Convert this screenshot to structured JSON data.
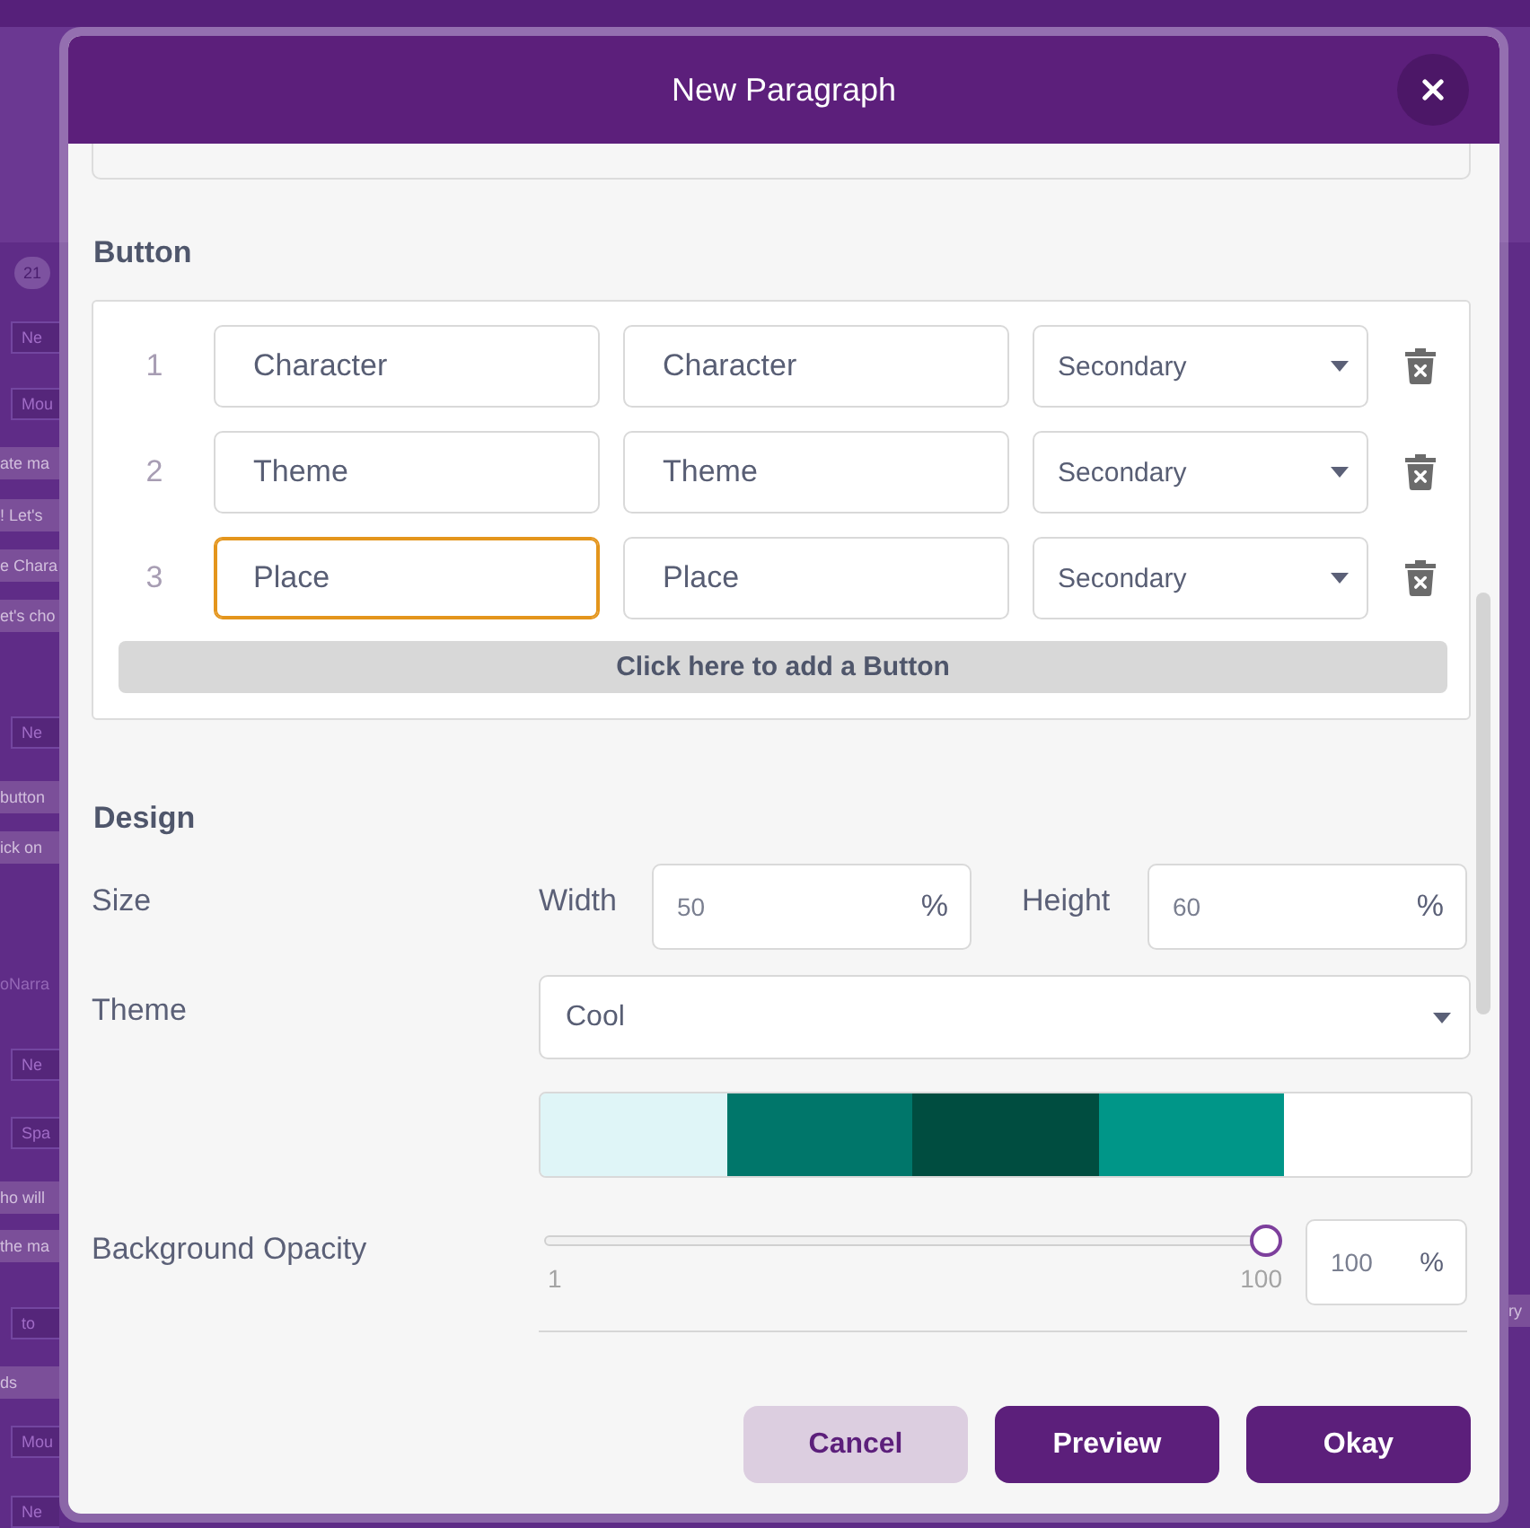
{
  "backdrop": {
    "left_fragments": [
      {
        "kind": "badge",
        "text": "21"
      },
      {
        "kind": "chip",
        "text": "Ne"
      },
      {
        "kind": "chip",
        "text": "Mou"
      },
      {
        "kind": "line",
        "text": "ate ma"
      },
      {
        "kind": "line",
        "text": "! Let's"
      },
      {
        "kind": "line",
        "text": "e Chara"
      },
      {
        "kind": "line",
        "text": "et's cho"
      },
      {
        "kind": "chip",
        "text": "Ne"
      },
      {
        "kind": "line",
        "text": "button"
      },
      {
        "kind": "line",
        "text": "ick on"
      },
      {
        "kind": "heading",
        "text": "oNarra"
      },
      {
        "kind": "chip",
        "text": "Ne"
      },
      {
        "kind": "chip",
        "text": "Spa"
      },
      {
        "kind": "line",
        "text": "ho will"
      },
      {
        "kind": "line",
        "text": "the ma"
      },
      {
        "kind": "chip",
        "text": "to"
      },
      {
        "kind": "line",
        "text": "ds"
      },
      {
        "kind": "chip",
        "text": "Mou"
      },
      {
        "kind": "chip",
        "text": "Ne"
      }
    ],
    "right_fragments": [
      {
        "kind": "line",
        "text": "ry"
      }
    ]
  },
  "dialog": {
    "title": "New Paragraph"
  },
  "button_section": {
    "heading": "Button",
    "rows": [
      {
        "number": "1",
        "fields": [
          {
            "value": "Character",
            "focused": false
          },
          {
            "value": "Character",
            "focused": false
          }
        ],
        "style": "Secondary"
      },
      {
        "number": "2",
        "fields": [
          {
            "value": "Theme",
            "focused": false
          },
          {
            "value": "Theme",
            "focused": false
          }
        ],
        "style": "Secondary"
      },
      {
        "number": "3",
        "fields": [
          {
            "value": "Place",
            "focused": true
          },
          {
            "value": "Place",
            "focused": false
          }
        ],
        "style": "Secondary"
      }
    ],
    "add_button": "Click here to add a Button"
  },
  "design_section": {
    "heading": "Design",
    "size": {
      "label": "Size",
      "width_label": "Width",
      "width_value": "50",
      "width_unit": "%",
      "height_label": "Height",
      "height_value": "60",
      "height_unit": "%"
    },
    "theme": {
      "label": "Theme",
      "value": "Cool",
      "palette": [
        {
          "color": "#dff5f7"
        },
        {
          "color": "#00766a"
        },
        {
          "color": "#004d40"
        },
        {
          "color": "#009688"
        },
        {
          "color": "#ffffff"
        }
      ]
    },
    "opacity": {
      "label": "Background Opacity",
      "level": 1,
      "min": "1",
      "max": "100",
      "value": "100",
      "unit": "%"
    }
  },
  "footer": {
    "buttons": [
      {
        "label": "Cancel",
        "kind": "secondary"
      },
      {
        "label": "Preview",
        "kind": "primary"
      },
      {
        "label": "Okay",
        "kind": "primary"
      }
    ]
  }
}
